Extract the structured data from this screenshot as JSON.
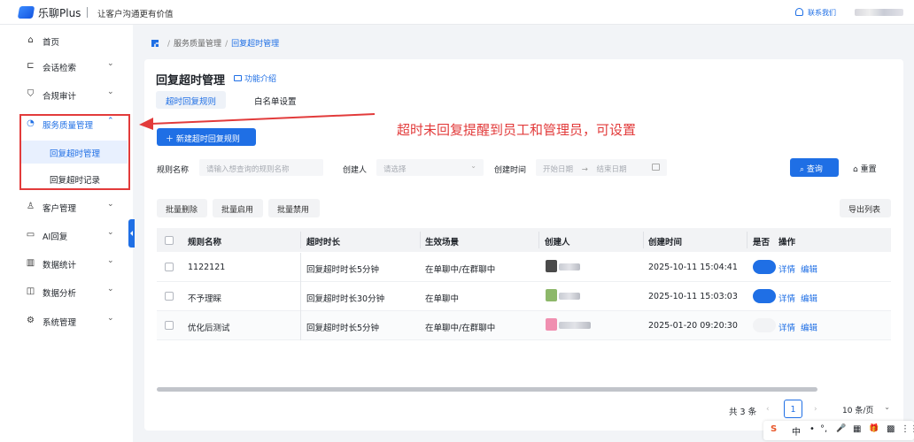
{
  "app": {
    "name": "乐聊Plus",
    "slogan": "让客户沟通更有价值",
    "contact_label": "联系我们"
  },
  "sidebar": {
    "items": [
      {
        "label": "首页",
        "icon": "home-icon",
        "glyph": "⌂"
      },
      {
        "label": "会话检索",
        "icon": "chat-search-icon",
        "glyph": "⊏"
      },
      {
        "label": "合规审计",
        "icon": "shield-icon",
        "glyph": "⛉"
      },
      {
        "label": "服务质量管理",
        "icon": "service-quality-icon",
        "glyph": "◔"
      },
      {
        "label": "客户管理",
        "icon": "customer-icon",
        "glyph": "♙"
      },
      {
        "label": "AI回复",
        "icon": "ai-reply-icon",
        "glyph": "▭"
      },
      {
        "label": "数据统计",
        "icon": "stats-icon",
        "glyph": "▥"
      },
      {
        "label": "数据分析",
        "icon": "analysis-icon",
        "glyph": "◫"
      },
      {
        "label": "系统管理",
        "icon": "settings-icon",
        "glyph": "⚙"
      }
    ],
    "sub_items": [
      {
        "label": "回复超时管理"
      },
      {
        "label": "回复超时记录"
      }
    ]
  },
  "breadcrumb": {
    "parent": "服务质量管理",
    "current": "回复超时管理"
  },
  "page": {
    "title": "回复超时管理",
    "feature_intro": "功能介绍",
    "tabs": [
      "超时回复规则",
      "白名单设置"
    ]
  },
  "annotation": {
    "text": "超时未回复提醒到员工和管理员，可设置"
  },
  "toolbar": {
    "new_rule": "新建超时回复规则",
    "batch_delete": "批量删除",
    "batch_enable": "批量启用",
    "batch_disable": "批量禁用",
    "export": "导出列表"
  },
  "filters": {
    "rule_name_label": "规则名称",
    "rule_name_placeholder": "请输入想查询的规则名称",
    "creator_label": "创建人",
    "creator_placeholder": "请选择",
    "created_time_label": "创建时间",
    "start_placeholder": "开始日期",
    "end_placeholder": "结束日期",
    "range_arrow": "→",
    "query": "查询",
    "reset": "重置"
  },
  "table": {
    "columns": [
      "规则名称",
      "超时时长",
      "生效场景",
      "创建人",
      "创建时间",
      "是否",
      "操作"
    ],
    "rows": [
      {
        "name": "1122121",
        "timeout": "回复超时时长5分钟",
        "scene": "在单聊中/在群聊中",
        "created": "2025-10-11 15:04:41",
        "enabled": true,
        "avatar_color": "#4a4a4a",
        "detail": "详情",
        "edit": "编辑"
      },
      {
        "name": "不予理睬",
        "timeout": "回复超时时长30分钟",
        "scene": "在单聊中",
        "created": "2025-10-11 15:03:03",
        "enabled": true,
        "avatar_color": "#8db86a",
        "detail": "详情",
        "edit": "编辑"
      },
      {
        "name": "优化后测试",
        "timeout": "回复超时时长5分钟",
        "scene": "在单聊中/在群聊中",
        "created": "2025-01-20 09:20:30",
        "enabled": false,
        "avatar_color": "#f08fb0",
        "detail": "详情",
        "edit": "编辑"
      }
    ]
  },
  "pagination": {
    "total": "共 3 条",
    "current": "1",
    "page_size": "10 条/页"
  },
  "ime_toolbar": {
    "items": [
      "S",
      "中",
      "•",
      "°,",
      "🎤",
      "▦",
      "🎁",
      "▩",
      "⋮⋮"
    ]
  },
  "colors": {
    "accent": "#1f6fe5",
    "annotation_red": "#e23b3b"
  }
}
